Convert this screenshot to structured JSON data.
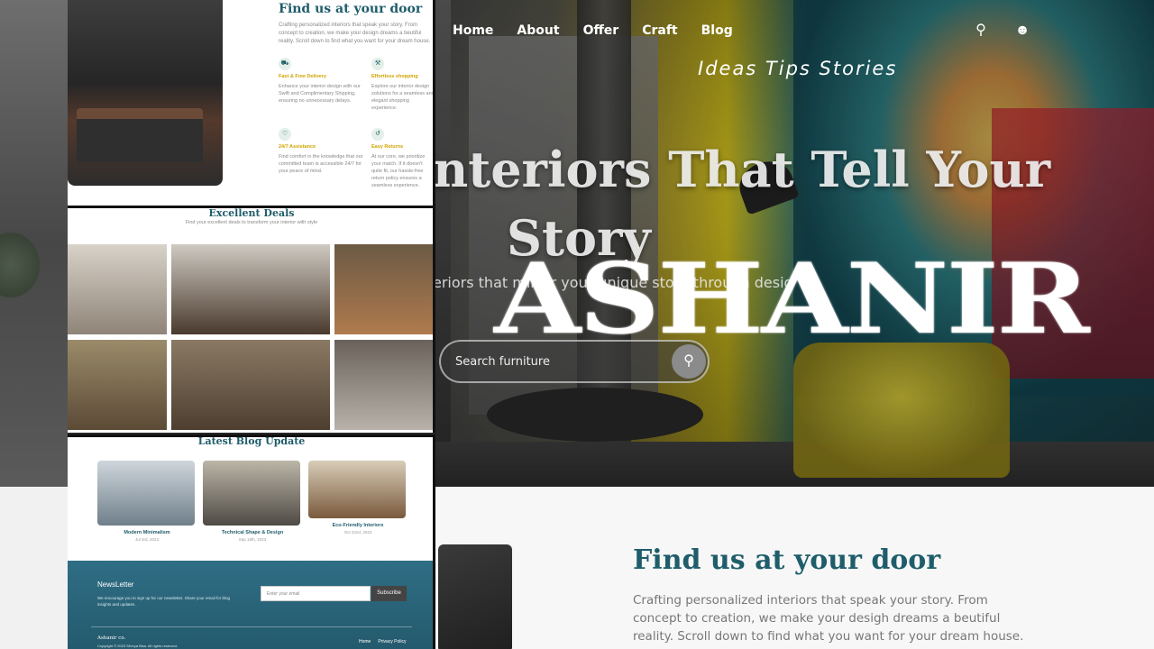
{
  "nav": {
    "items": [
      "Home",
      "About",
      "Offer",
      "Craft",
      "Blog"
    ],
    "search_icon": "search-icon",
    "user_icon": "user-icon"
  },
  "hero": {
    "tagline": "Ideas Tips Stories",
    "title_line1": "nteriors That Tell Your",
    "title_line2": "Story",
    "subtitle": "eriors that mirror your unique story through design",
    "brand": "ASHANIR",
    "search_placeholder": "Search furniture"
  },
  "find_section": {
    "title": "Find us at your door",
    "text": "Crafting personalized interiors that speak your story. From concept to creation, we make your desigh dreams a beutiful reality. Scroll down to find what you want for your dream house."
  },
  "preview": {
    "find": {
      "title": "Find us at your door",
      "text": "Crafting personalized interiors that speak your story. From concept to creation, we make your design dreams a beutiful reality. Scroll down to find what you want for your dream house.",
      "features": [
        {
          "icon": "truck-icon",
          "title": "Fast & Free Delivery",
          "text": "Enhance your interior design with our Swift and Complimentary Shipping, ensuring no unnecessary delays."
        },
        {
          "icon": "cart-icon",
          "title": "Effortless shopping",
          "text": "Explore our interior design solutions for a seamless and elegant shopping experience."
        },
        {
          "icon": "heart-icon",
          "title": "24/7 Assistance",
          "text": "Find comfort in the knowledge that our committed team is accessible 24/7 for your peace of mind."
        },
        {
          "icon": "return-icon",
          "title": "Easy Returns",
          "text": "At our core, we prioritize your match. If it doesn't quite fit, our hassle-free return policy ensures a seamless experience."
        }
      ]
    },
    "deals": {
      "title": "Excellent Deals",
      "subtitle": "Find your excellent deals to transform your interior with style"
    },
    "blog": {
      "title": "Latest Blog Update",
      "posts": [
        {
          "title": "Modern Minimalism",
          "date": "Jul 3rd, 2023"
        },
        {
          "title": "Technical Shape & Design",
          "date": "Sep 18th, 2023"
        },
        {
          "title": "Eco-Friendly Interiors",
          "date": "Oct 22nd, 2023"
        }
      ]
    },
    "newsletter": {
      "title": "NewsLetter",
      "text": "We encourage you to sign up for our newsletter. Share your email for blog insights and updates.",
      "email_placeholder": "Enter your email",
      "subscribe": "Subscribe",
      "brand": "Ashanir co.",
      "copyright": "Copyright © 2023 Shreya Bisa. All rights reserved.",
      "links": [
        "Home",
        "Privacy Policy"
      ]
    }
  }
}
